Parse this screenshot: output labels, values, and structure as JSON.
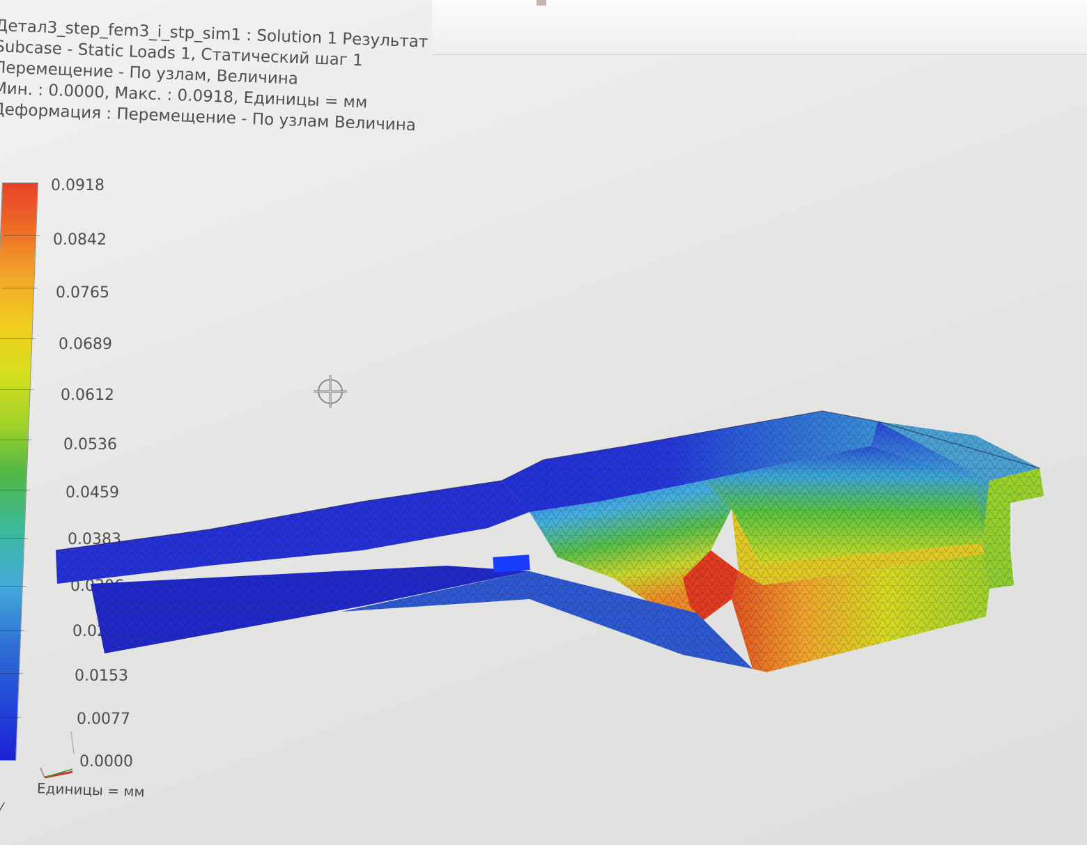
{
  "header": {
    "title": "Детал3_step_fem3_i_stp_sim1 : Solution 1 Результат",
    "subcase": "Subcase - Static Loads 1, Статический шаг 1",
    "result_type": "Перемещение - По узлам, Величина",
    "range": "Мин. : 0.0000, Макс. : 0.0918, Единицы = мм",
    "deformation": "Деформация : Перемещение - По узлам Величина"
  },
  "legend": {
    "labels": [
      "0.0918",
      "0.0842",
      "0.0765",
      "0.0689",
      "0.0612",
      "0.0536",
      "0.0459",
      "0.0383",
      "0.0306",
      "0.0230",
      "0.0153",
      "0.0077",
      "0.0000"
    ],
    "units": "Единицы = мм",
    "colors": [
      "#e8412a",
      "#ee6c25",
      "#f2a52a",
      "#f0cf1f",
      "#d6df1e",
      "#9fd12a",
      "#54b843",
      "#3bb99c",
      "#44a9d8",
      "#2f6fd6",
      "#2347d8",
      "#1b22d6"
    ]
  },
  "viewport": {
    "background": "#e6e6e4",
    "cursor_icon": "move-crosshair-icon",
    "triad_icon": "axis-triad-icon"
  }
}
